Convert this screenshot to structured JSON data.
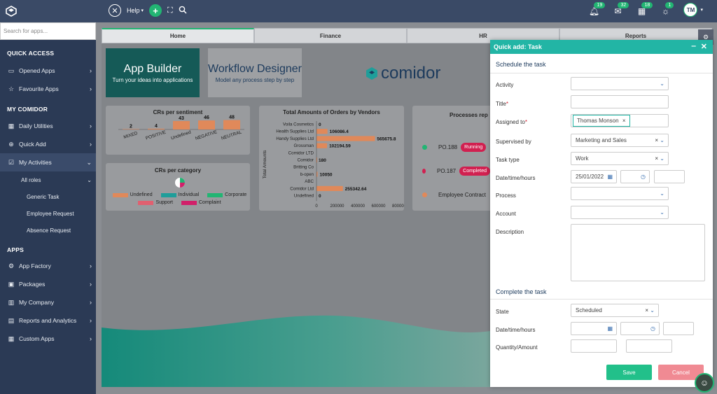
{
  "topbar": {
    "help_label": "Help",
    "badges": {
      "notifications": "19",
      "messages": "32",
      "calendar": "18",
      "tasks": "1"
    },
    "avatar_initials": "TM"
  },
  "sidebar": {
    "search_placeholder": "Search for apps...",
    "quick_access_title": "QUICK ACCESS",
    "quick_access": [
      {
        "label": "Opened Apps"
      },
      {
        "label": "Favourite Apps"
      }
    ],
    "my_comidor_title": "MY COMIDOR",
    "my_comidor": [
      {
        "label": "Daily Utilities"
      },
      {
        "label": "Quick Add"
      },
      {
        "label": "My Activities"
      }
    ],
    "all_roles": "All roles",
    "roles": [
      {
        "label": "Generic Task"
      },
      {
        "label": "Employee Request"
      },
      {
        "label": "Absence Request"
      }
    ],
    "apps_title": "APPS",
    "apps": [
      {
        "label": "App Factory"
      },
      {
        "label": "Packages"
      },
      {
        "label": "My Company"
      },
      {
        "label": "Reports and Analytics"
      },
      {
        "label": "Custom Apps"
      }
    ]
  },
  "tabs": [
    {
      "label": "Home"
    },
    {
      "label": "Finance"
    },
    {
      "label": "HR"
    },
    {
      "label": "Reports"
    }
  ],
  "dashboard": {
    "app_builder": {
      "title": "App Builder",
      "subtitle": "Turn your ideas into applications"
    },
    "workflow_designer": {
      "title": "Workflow Designer",
      "subtitle": "Model any process step by step"
    },
    "brand": "comidor",
    "processes_title": "Processes rep",
    "processes": [
      {
        "label": "PO.188",
        "status": "Running",
        "dot": "#22b573",
        "color": "#d12050"
      },
      {
        "label": "PO.187",
        "status": "Completed",
        "dot": "#d12050",
        "color": "#d12050"
      },
      {
        "label": "Employee Contract",
        "status": "",
        "dot": "#e0895a",
        "color": ""
      }
    ]
  },
  "chart_data": [
    {
      "type": "bar",
      "title": "CRs per sentiment",
      "categories": [
        "MIXED",
        "POSITIVE",
        "Undefined",
        "NEGATIVE",
        "NEUTRAL"
      ],
      "values": [
        2,
        4,
        43,
        46,
        48
      ]
    },
    {
      "type": "bar",
      "title": "Total Amounts of Orders by Vendors",
      "ylabel": "Total Amounts",
      "categories": [
        "Voila Cosmetics",
        "Health Supplies Ltd",
        "Handy Supplies Ltd",
        "Grossman",
        "Comidor LTD",
        "Comidor",
        "Britting Co",
        "b-open",
        "ABC",
        "Comidor Ltd",
        "Undefined"
      ],
      "values": [
        0,
        106086.4,
        565675.8,
        102194.59,
        0,
        180,
        0,
        10050,
        0,
        255342.64,
        0
      ],
      "value_labels": [
        "0",
        "106086.4",
        "565675.8",
        "102194.59",
        "",
        "180",
        "",
        "10050",
        "",
        "255342.64",
        "0"
      ],
      "x_ticks": [
        "0",
        "200000",
        "400000",
        "600000",
        "800000"
      ],
      "xlim": [
        0,
        800000
      ]
    },
    {
      "type": "pie",
      "title": "CRs per category",
      "legend": [
        {
          "name": "Undefined",
          "color": "#e0895a"
        },
        {
          "name": "Individual",
          "color": "#1f9e9a"
        },
        {
          "name": "Corporate",
          "color": "#22b573"
        },
        {
          "name": "Support",
          "color": "#e06070"
        },
        {
          "name": "Complaint",
          "color": "#d1206a"
        }
      ]
    }
  ],
  "quick_add": {
    "title": "Quick add: Task",
    "schedule_section": "Schedule the task",
    "activity_label": "Activity",
    "title_label": "Title",
    "assigned_label": "Assigned to",
    "assigned_value": "Thomas Monson",
    "supervised_label": "Supervised by",
    "supervised_value": "Marketing and Sales",
    "task_type_label": "Task type",
    "task_type_value": "Work",
    "datetime_label": "Date/time/hours",
    "date_value": "25/01/2022",
    "process_label": "Process",
    "account_label": "Account",
    "description_label": "Description",
    "complete_section": "Complete the task",
    "state_label": "State",
    "state_value": "Scheduled",
    "datetime2_label": "Date/time/hours",
    "quantity_label": "Quantity/Amount",
    "save_label": "Save",
    "cancel_label": "Cancel"
  }
}
